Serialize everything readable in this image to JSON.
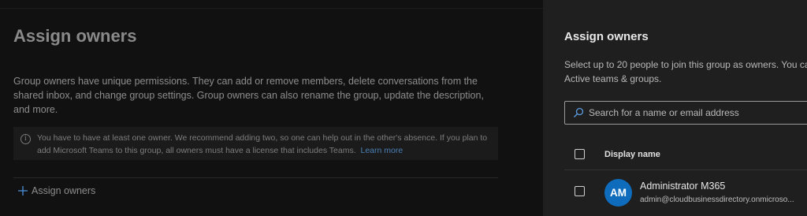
{
  "background_page": {
    "title": "Assign owners",
    "description": "Group owners have unique permissions. They can add or remove members, delete conversations from the shared inbox, and change group settings. Group owners can also rename the group, update the description, and more.",
    "info_banner": {
      "icon": "info-icon",
      "text": "You have to have at least one owner. We recommend adding two, so one can help out in the other's absence. If you plan to add Microsoft Teams to this group, all owners must have a license that includes Teams.",
      "link": "Learn more"
    },
    "assign_button_label": "Assign owners"
  },
  "panel": {
    "title": "Assign owners",
    "description_line1": "Select up to 20 people to join this group as owners. You ca",
    "description_line2": "Active teams & groups.",
    "search": {
      "placeholder": "Search for a name or email address"
    },
    "table": {
      "column_header": "Display name",
      "rows": [
        {
          "initials": "AM",
          "name": "Administrator M365",
          "email": "admin@cloudbusinessdirectory.onmicroso..."
        }
      ]
    }
  },
  "colors": {
    "accent": "#0f6cbd",
    "link": "#4a7fb5",
    "panel_background": "#1f1f1f",
    "page_background": "#111111"
  }
}
